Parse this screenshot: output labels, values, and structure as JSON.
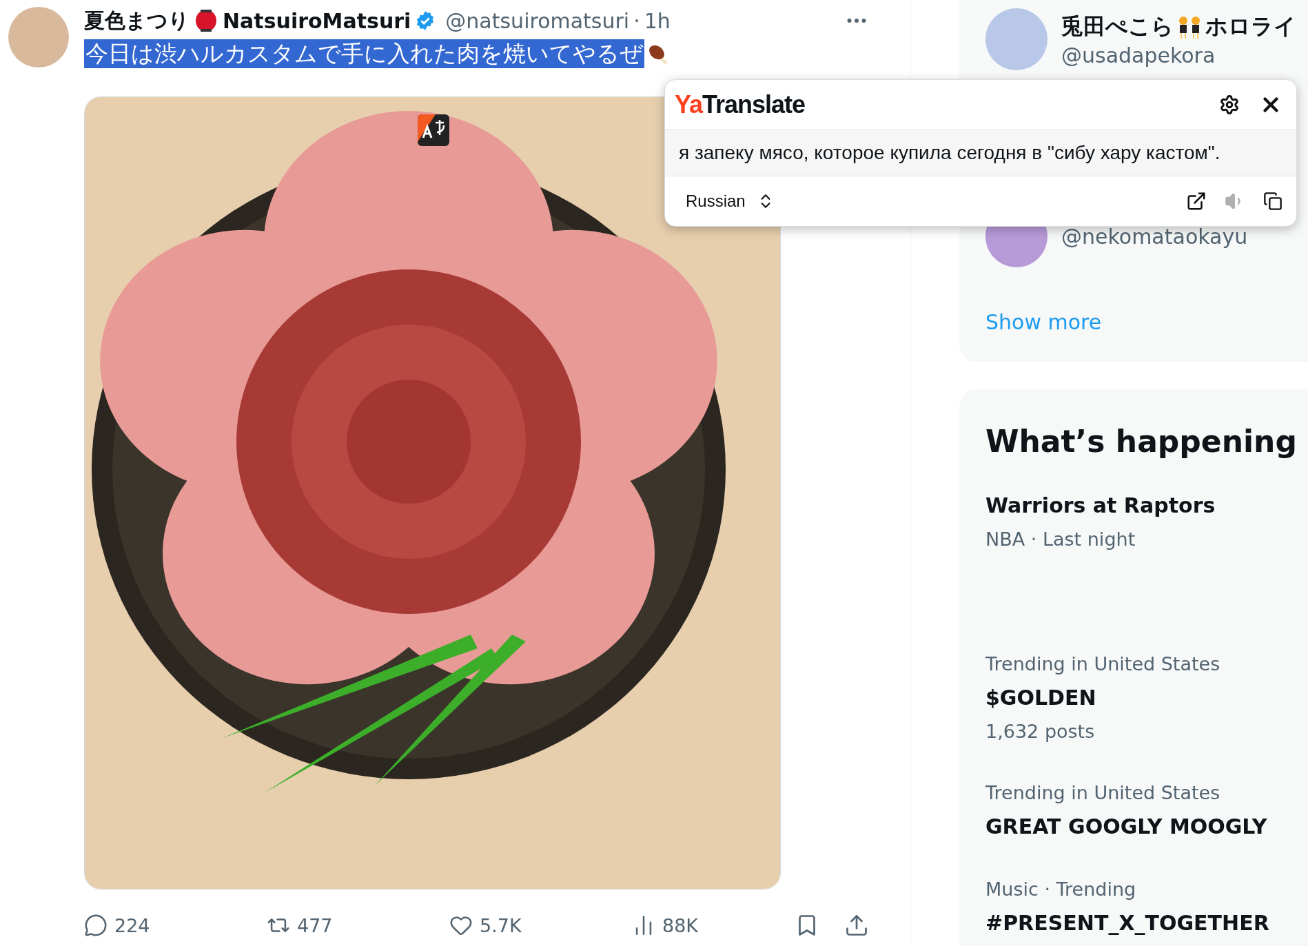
{
  "tweet": {
    "author_name": "夏色まつり",
    "author_name_latin": "NatsuiroMatsuri",
    "verified": true,
    "handle": "@natsuiromatsuri",
    "separator": "·",
    "time": "1h",
    "text": "今日は渋ハルカスタムで手に入れた肉を焼いてやるぜ",
    "text_selected": true,
    "actions": [
      {
        "kind": "reply",
        "count": "224"
      },
      {
        "kind": "repost",
        "count": "477"
      },
      {
        "kind": "like",
        "count": "5.7K"
      },
      {
        "kind": "views",
        "count": "88K"
      }
    ]
  },
  "translate_popup": {
    "logo_accent": "Ya",
    "logo_text": "Translate",
    "translation": "я запеку мясо, которое купила сегодня в \"сибу хару кастом\".",
    "language": "Russian",
    "speak_disabled": true
  },
  "who_to_follow": {
    "users": [
      {
        "name": "兎田ぺこら",
        "name_suffix": "ホロライ",
        "handle": "@usadapekora"
      },
      {
        "handle": "@nekomataokayu"
      }
    ],
    "show_more": "Show more"
  },
  "whats_happening": {
    "title": "What’s happening",
    "items": [
      {
        "kind": "event",
        "title": "Warriors at Raptors",
        "context": "NBA · Last night"
      },
      {
        "kind": "trend",
        "context": "Trending in United States",
        "title": "$GOLDEN",
        "posts": "1,632 posts"
      },
      {
        "kind": "trend",
        "context": "Trending in United States",
        "title": "GREAT GOOGLY MOOGLY"
      },
      {
        "kind": "trend",
        "context": "Music · Trending",
        "title": "#PRESENT_X_TOGETHER"
      }
    ]
  }
}
